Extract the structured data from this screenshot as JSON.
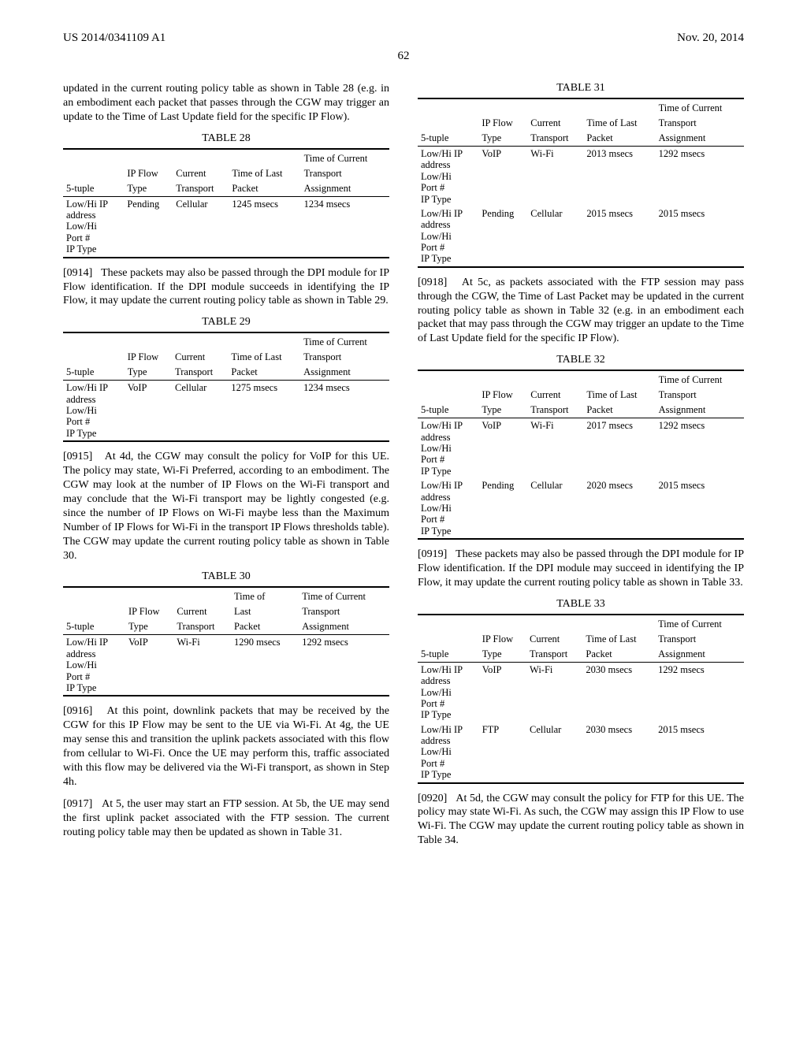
{
  "header": {
    "left": "US 2014/0341109 A1",
    "right": "Nov. 20, 2014"
  },
  "page_number": "62",
  "left_col": {
    "p0": "updated in the current routing policy table as shown in Table 28 (e.g. in an embodiment each packet that passes through the CGW may trigger an update to the Time of Last Update field for the specific IP Flow).",
    "t28_caption": "TABLE 28",
    "cols": {
      "c1": "5-tuple",
      "c2_a": "IP Flow",
      "c2_b": "Type",
      "c3_a": "Current",
      "c3_b": "Transport",
      "c4_a": "Time of Last",
      "c4_b": "Packet",
      "c5_a": "Time of Current",
      "c5_b": "Transport",
      "c5_c": "Assignment"
    },
    "t28_row": {
      "tuple_l1": "Low/Hi IP",
      "tuple_l2": "address",
      "tuple_l3": "Low/Hi",
      "tuple_l4": "Port #",
      "tuple_l5": "IP Type",
      "type": "Pending",
      "transport": "Cellular",
      "last": "1245 msecs",
      "assign": "1234 msecs"
    },
    "p0914_ref": "[0914]",
    "p0914": "These packets may also be passed through the DPI module for IP Flow identification. If the DPI module succeeds in identifying the IP Flow, it may update the current routing policy table as shown in Table 29.",
    "t29_caption": "TABLE 29",
    "t29_row": {
      "type": "VoIP",
      "transport": "Cellular",
      "last": "1275 msecs",
      "assign": "1234 msecs"
    },
    "p0915_ref": "[0915]",
    "p0915": "At 4d, the CGW may consult the policy for VoIP for this UE. The policy may state, Wi-Fi Preferred, according to an embodiment. The CGW may look at the number of IP Flows on the Wi-Fi transport and may conclude that the Wi-Fi transport may be lightly congested (e.g. since the number of IP Flows on Wi-Fi maybe less than the Maximum Number of IP Flows for Wi-Fi in the transport IP Flows thresholds table). The CGW may update the current routing policy table as shown in Table 30.",
    "t30_caption": "TABLE 30",
    "t30_cols": {
      "c4_a": "Time of",
      "c4_b": "Last",
      "c4_c": "Packet"
    },
    "t30_row": {
      "type": "VoIP",
      "transport": "Wi-Fi",
      "last": "1290 msecs",
      "assign": "1292 msecs"
    },
    "p0916_ref": "[0916]",
    "p0916": "At this point, downlink packets that may be received by the CGW for this IP Flow may be sent to the UE via Wi-Fi. At 4g, the UE may sense this and transition the uplink packets associated with this flow from cellular to Wi-Fi. Once the UE may perform this, traffic associated with this flow may be delivered via the Wi-Fi transport, as shown in Step 4h.",
    "p0917_ref": "[0917]",
    "p0917": "At 5, the user may start an FTP session. At 5b, the UE may send the first uplink packet associated with the FTP session. The current routing policy table may then be updated as shown in Table 31."
  },
  "right_col": {
    "t31_caption": "TABLE 31",
    "t31_r1": {
      "type": "VoIP",
      "transport": "Wi-Fi",
      "last": "2013 msecs",
      "assign": "1292 msecs"
    },
    "t31_r2": {
      "type": "Pending",
      "transport": "Cellular",
      "last": "2015 msecs",
      "assign": "2015 msecs"
    },
    "p0918_ref": "[0918]",
    "p0918": "At 5c, as packets associated with the FTP session may pass through the CGW, the Time of Last Packet may be updated in the current routing policy table as shown in Table 32 (e.g. in an embodiment each packet that may pass through the CGW may trigger an update to the Time of Last Update field for the specific IP Flow).",
    "t32_caption": "TABLE 32",
    "t32_r1": {
      "type": "VoIP",
      "transport": "Wi-Fi",
      "last": "2017 msecs",
      "assign": "1292 msecs"
    },
    "t32_r2": {
      "type": "Pending",
      "transport": "Cellular",
      "last": "2020 msecs",
      "assign": "2015 msecs"
    },
    "p0919_ref": "[0919]",
    "p0919": "These packets may also be passed through the DPI module for IP Flow identification. If the DPI module may succeed in identifying the IP Flow, it may update the current routing policy table as shown in Table 33.",
    "t33_caption": "TABLE 33",
    "t33_r1": {
      "type": "VoIP",
      "transport": "Wi-Fi",
      "last": "2030 msecs",
      "assign": "1292 msecs"
    },
    "t33_r2": {
      "type": "FTP",
      "transport": "Cellular",
      "last": "2030 msecs",
      "assign": "2015 msecs"
    },
    "p0920_ref": "[0920]",
    "p0920": "At 5d, the CGW may consult the policy for FTP for this UE. The policy may state Wi-Fi. As such, the CGW may assign this IP Flow to use Wi-Fi. The CGW may update the current routing policy table as shown in Table 34."
  }
}
